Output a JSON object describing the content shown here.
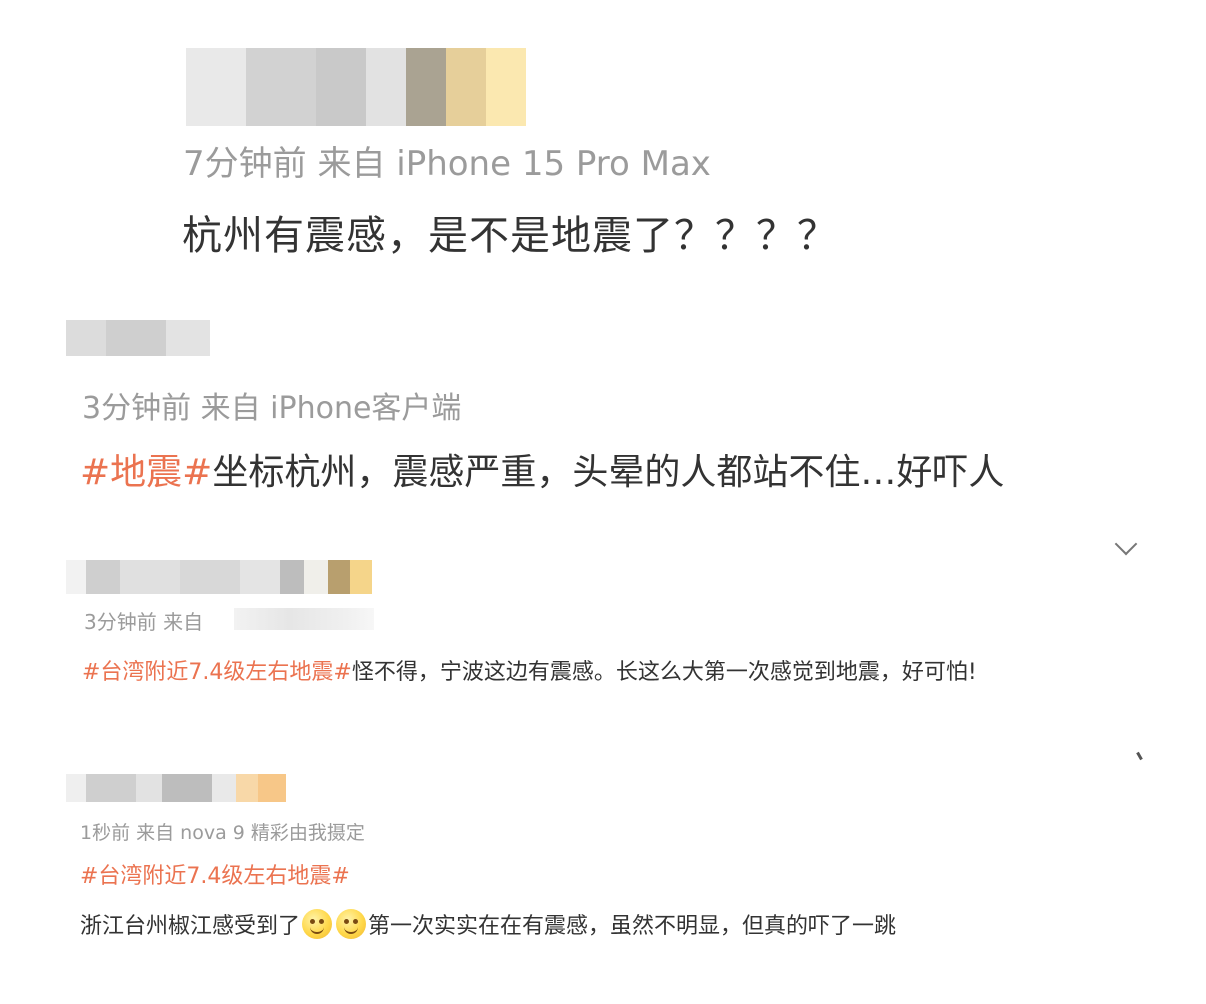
{
  "posts": [
    {
      "meta": "7分钟前  来自 iPhone 15 Pro Max",
      "content": "杭州有震感，是不是地震了？？？？"
    },
    {
      "meta": "3分钟前  来自 iPhone客户端",
      "hashtag": "#地震#",
      "content": "坐标杭州，震感严重，头晕的人都站不住…好吓人"
    },
    {
      "meta": "3分钟前  来自 ",
      "hashtag": "#台湾附近7.4级左右地震#",
      "content": "怪不得，宁波这边有震感。长这么大第一次感觉到地震，好可怕!"
    },
    {
      "meta": "1秒前  来自 nova 9 精彩由我摄定",
      "hashtag": "#台湾附近7.4级左右地震#",
      "content_before_emoji": "浙江台州椒江感受到了",
      "content_after_emoji": "第一次实实在在有震感，虽然不明显，但真的吓了一跳"
    }
  ],
  "icons": {
    "expand": "chevron-down-icon",
    "emoji": "smile-emoji-icon"
  },
  "colors": {
    "hashtag": "#eb7350",
    "meta": "#9b9b9b",
    "text": "#333333"
  }
}
